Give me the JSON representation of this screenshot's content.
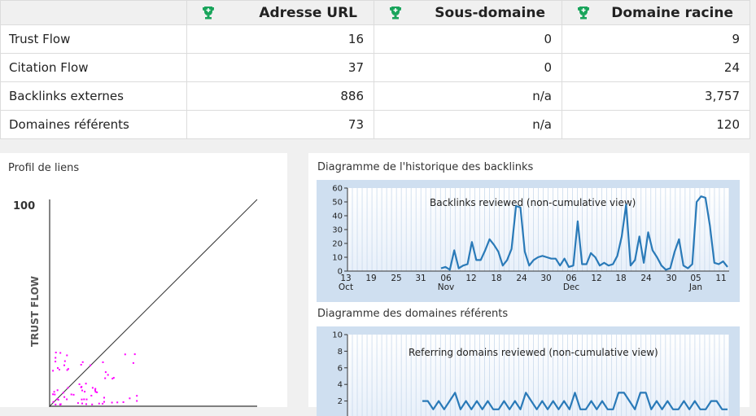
{
  "table": {
    "headers": [
      "Adresse URL",
      "Sous-domaine",
      "Domaine racine"
    ],
    "rows": [
      {
        "label": "Trust Flow",
        "values": [
          "16",
          "0",
          "9"
        ]
      },
      {
        "label": "Citation Flow",
        "values": [
          "37",
          "0",
          "24"
        ]
      },
      {
        "label": "Backlinks externes",
        "values": [
          "886",
          "n/a",
          "3,757"
        ]
      },
      {
        "label": "Domaines référents",
        "values": [
          "73",
          "n/a",
          "120"
        ]
      }
    ]
  },
  "link_profile": {
    "title": "Profil de liens",
    "y_axis_label": "TRUST FLOW",
    "y_max_label": "100",
    "point_color": "#ff00ff"
  },
  "charts": {
    "backlinks_title": "Diagramme de l'historique des backlinks",
    "referring_title": "Diagramme des domaines référents"
  },
  "chart_data": [
    {
      "type": "line",
      "title": "Backlinks reviewed (non-cumulative view)",
      "ylim": [
        0,
        60
      ],
      "y_ticks": [
        "0",
        "10",
        "20",
        "30",
        "40",
        "50",
        "60"
      ],
      "x_tick_labels": [
        "13",
        "19",
        "25",
        "31",
        "06",
        "12",
        "18",
        "24",
        "30",
        "06",
        "12",
        "18",
        "24",
        "30",
        "05",
        "11"
      ],
      "month_labels": [
        "Oct",
        "Nov",
        "Dec",
        "Jan"
      ],
      "series": [
        {
          "color": "#2a7ab8",
          "values": [
            2,
            3,
            1,
            15,
            2,
            4,
            5,
            21,
            8,
            8,
            15,
            23,
            19,
            14,
            4,
            8,
            16,
            47,
            46,
            14,
            4,
            8,
            10,
            11,
            10,
            9,
            9,
            4,
            9,
            3,
            4,
            36,
            5,
            5,
            13,
            10,
            4,
            6,
            4,
            5,
            11,
            25,
            48,
            4,
            8,
            25,
            6,
            28,
            15,
            10,
            4,
            1,
            2,
            14,
            23,
            4,
            2,
            5,
            50,
            54,
            53,
            33,
            6,
            5,
            7,
            3
          ]
        }
      ]
    },
    {
      "type": "line",
      "title": "Referring domains reviewed (non-cumulative view)",
      "ylim": [
        0,
        10
      ],
      "y_ticks": [
        "2",
        "4",
        "6",
        "8",
        "10"
      ],
      "series": [
        {
          "color": "#2a7ab8",
          "values": [
            2,
            2,
            1,
            2,
            1,
            2,
            3,
            1,
            2,
            1,
            2,
            1,
            2,
            1,
            1,
            2,
            1,
            2,
            1,
            3,
            2,
            1,
            2,
            1,
            2,
            1,
            2,
            1,
            3,
            1,
            1,
            2,
            1,
            2,
            1,
            1,
            3,
            3,
            2,
            1,
            3,
            3,
            1,
            2,
            1,
            2,
            1,
            1,
            2,
            1,
            2,
            1,
            1,
            2,
            2,
            1,
            1
          ]
        }
      ]
    }
  ]
}
